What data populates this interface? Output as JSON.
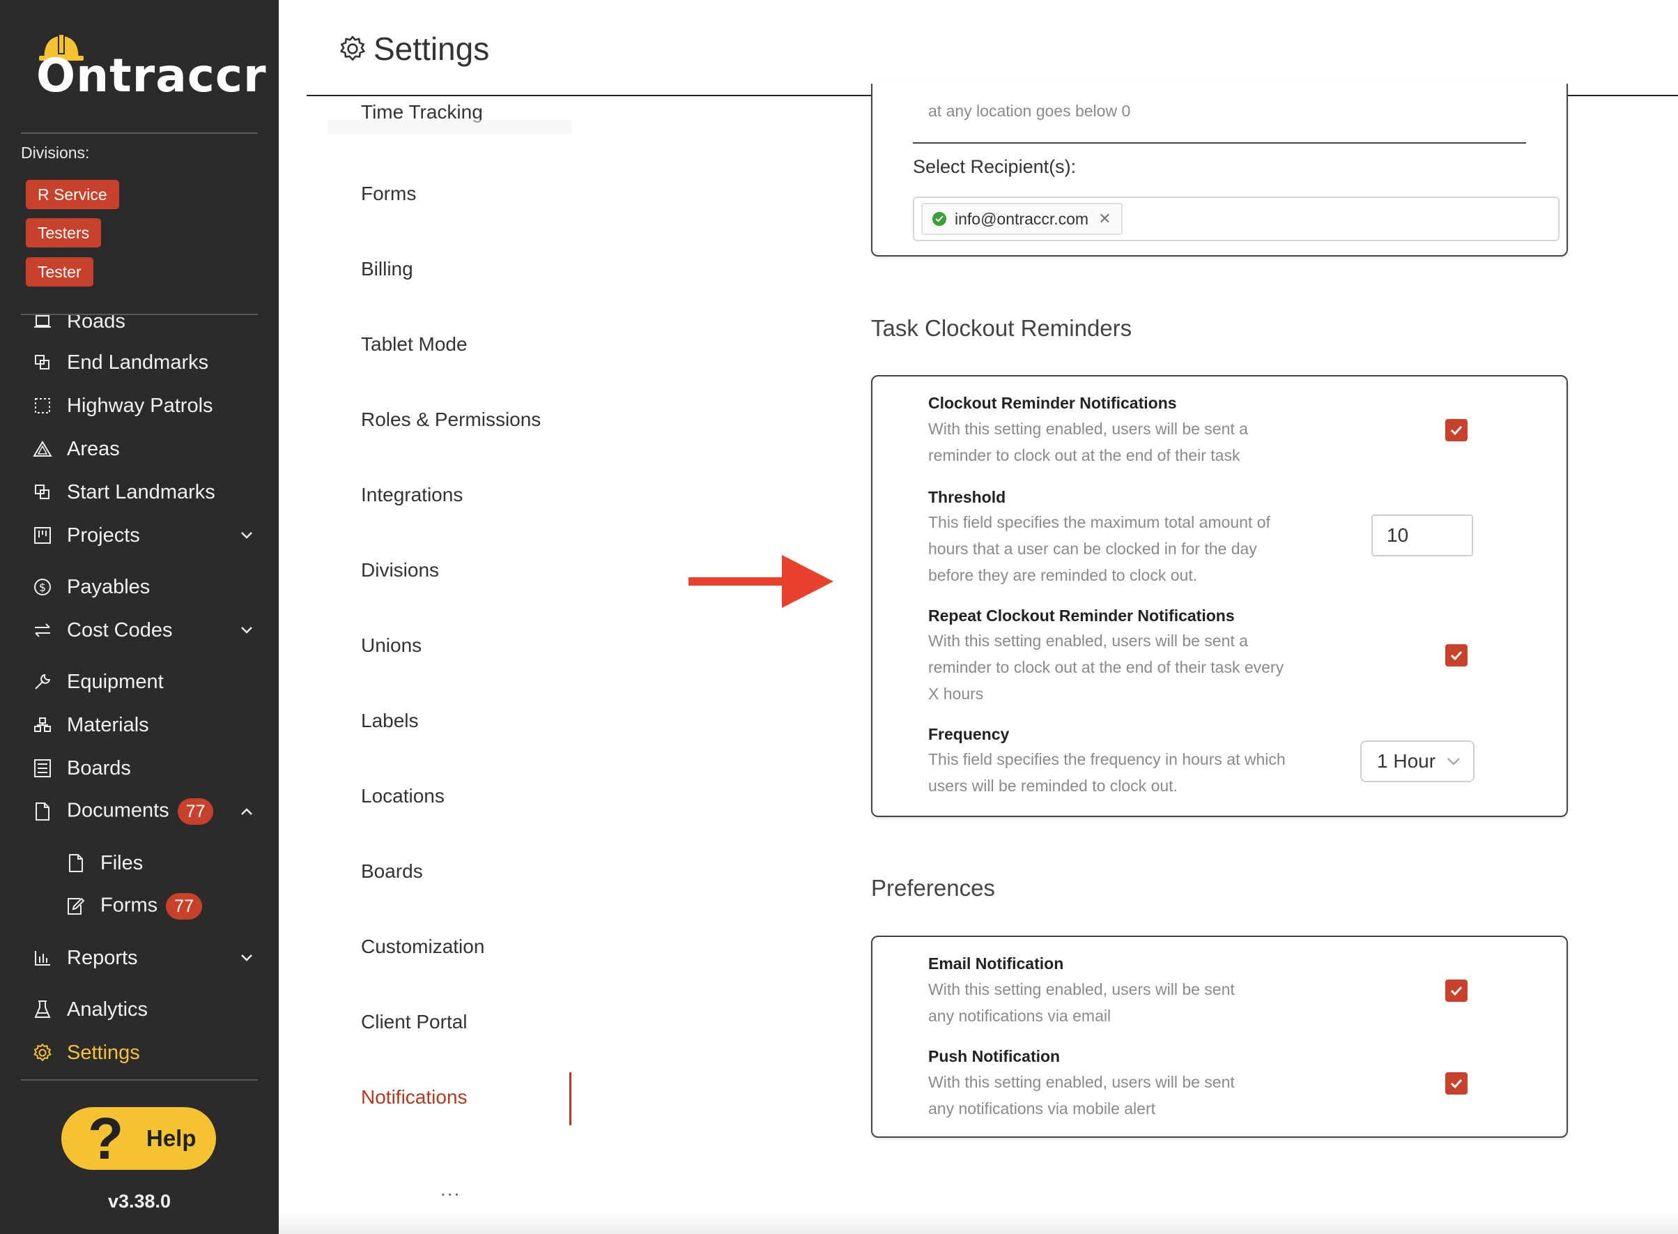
{
  "app": {
    "name": "Ontraccr",
    "version": "v3.38.0"
  },
  "sidebar": {
    "divisions_label": "Divisions:",
    "divisions": [
      "R Service",
      "Testers",
      "Tester"
    ],
    "items": [
      {
        "label": "Roads",
        "icon": "road-icon"
      },
      {
        "label": "End Landmarks",
        "icon": "landmark-icon"
      },
      {
        "label": "Highway Patrols",
        "icon": "patrol-icon"
      },
      {
        "label": "Areas",
        "icon": "area-icon"
      },
      {
        "label": "Start Landmarks",
        "icon": "landmark-icon"
      },
      {
        "label": "Projects",
        "icon": "projects-icon"
      },
      {
        "label": "Payables",
        "icon": "dollar-icon"
      },
      {
        "label": "Cost Codes",
        "icon": "swap-icon"
      },
      {
        "label": "Equipment",
        "icon": "wrench-icon"
      },
      {
        "label": "Materials",
        "icon": "materials-icon"
      },
      {
        "label": "Boards",
        "icon": "board-icon"
      },
      {
        "label": "Documents",
        "icon": "document-icon",
        "badge": "77"
      },
      {
        "label": "Files",
        "icon": "file-icon"
      },
      {
        "label": "Forms",
        "icon": "form-edit-icon",
        "badge": "77"
      },
      {
        "label": "Reports",
        "icon": "chart-icon"
      },
      {
        "label": "Analytics",
        "icon": "flask-icon"
      },
      {
        "label": "Settings",
        "icon": "gear-icon"
      }
    ],
    "help_label": "Help",
    "help_glyph": "?"
  },
  "header": {
    "title": "Settings"
  },
  "settings_nav": {
    "clipped_item": "Time Tracking",
    "items": [
      "Forms",
      "Billing",
      "Tablet Mode",
      "Roles & Permissions",
      "Integrations",
      "Divisions",
      "Unions",
      "Labels",
      "Locations",
      "Boards",
      "Customization",
      "Client Portal",
      "Notifications"
    ],
    "active": "Notifications",
    "more": "..."
  },
  "top_card": {
    "clipped_text": "at any location goes below 0",
    "recipient_label": "Select Recipient(s):",
    "recipient": "info@ontraccr.com"
  },
  "task_clockout": {
    "section_title": "Task Clockout Reminders",
    "reminder": {
      "title": "Clockout Reminder Notifications",
      "desc": "With this setting enabled, users will be sent a reminder to clock out at the end of their task",
      "checked": true
    },
    "threshold": {
      "title": "Threshold",
      "desc": "This field specifies the maximum total amount of hours that a user can be clocked in for the day before they are reminded to clock out.",
      "value": "10"
    },
    "repeat": {
      "title": "Repeat Clockout Reminder Notifications",
      "desc": "With this setting enabled, users will be sent a reminder to clock out at the end of their task every X hours",
      "checked": true
    },
    "frequency": {
      "title": "Frequency",
      "desc": "This field specifies the frequency in hours at which users will be reminded to clock out.",
      "value": "1 Hour"
    }
  },
  "preferences": {
    "section_title": "Preferences",
    "email": {
      "title": "Email Notification",
      "desc": "With this setting enabled, users will be sent any notifications via email",
      "checked": true
    },
    "push": {
      "title": "Push Notification",
      "desc": "With this setting enabled, users will be sent any notifications via mobile alert",
      "checked": true
    }
  },
  "colors": {
    "sidebar_bg": "#2b2b2b",
    "accent_red": "#c8412b",
    "active_nav": "#b23a22",
    "settings_active": "#f5c13a",
    "help_yellow": "#f5c232",
    "arrow_red": "#e8412c"
  }
}
